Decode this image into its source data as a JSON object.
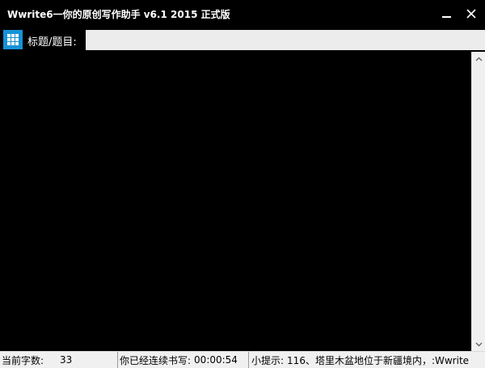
{
  "window": {
    "title": "Wwrite6一你的原创写作助手 v6.1 2015 正式版"
  },
  "header": {
    "title_label": "标题/题目:",
    "title_value": ""
  },
  "editor": {
    "content": ""
  },
  "statusbar": {
    "char_count_label": "当前字数:",
    "char_count_value": "33",
    "writing_time_label": "你已经连续书写:",
    "writing_time_value": "00:00:54",
    "tip_label": "小提示:",
    "tip_text": "116、塔里木盆地位于新疆境内，:Wwrite"
  },
  "icons": {
    "menu": "grid-icon",
    "minimize": "minimize-icon",
    "close": "close-icon",
    "scroll_up": "chevron-up-icon",
    "scroll_down": "chevron-down-icon"
  },
  "colors": {
    "background": "#000000",
    "accent": "#1692d8",
    "input_bg": "#ececec",
    "statusbar_bg": "#f0f0f0"
  }
}
